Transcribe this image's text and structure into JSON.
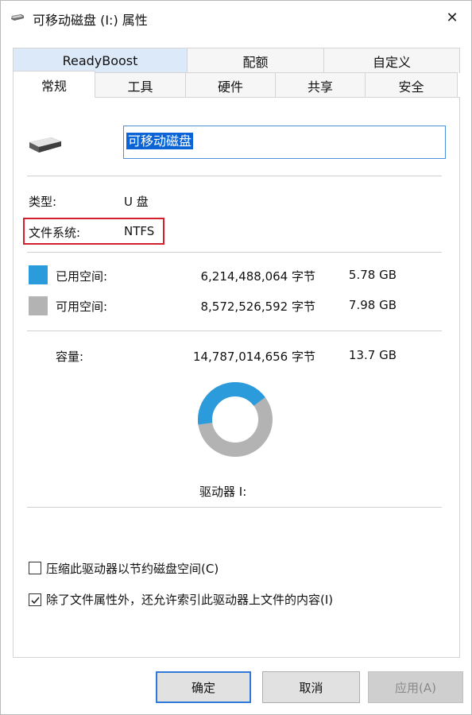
{
  "window": {
    "title": "可移动磁盘 (I:) 属性",
    "close_glyph": "✕"
  },
  "tabs": {
    "back_row": [
      {
        "label": "ReadyBoost",
        "highlight": true
      },
      {
        "label": "配额"
      },
      {
        "label": "自定义"
      }
    ],
    "front_row": [
      {
        "label": "常规",
        "active": true
      },
      {
        "label": "工具"
      },
      {
        "label": "硬件"
      },
      {
        "label": "共享"
      },
      {
        "label": "安全"
      }
    ]
  },
  "general": {
    "drive_name": "可移动磁盘",
    "type_label": "类型:",
    "type_value": "U 盘",
    "fs_label": "文件系统:",
    "fs_value": "NTFS",
    "used": {
      "label": "已用空间:",
      "bytes": "6,214,488,064 字节",
      "size": "5.78 GB",
      "color": "#2b9bdc"
    },
    "free": {
      "label": "可用空间:",
      "bytes": "8,572,526,592 字节",
      "size": "7.98 GB",
      "color": "#b3b3b3"
    },
    "capacity": {
      "label": "容量:",
      "bytes": "14,787,014,656 字节",
      "size": "13.7 GB"
    },
    "drive_label": "驱动器 I:",
    "used_fraction": 0.42
  },
  "options": {
    "compress": {
      "label": "压缩此驱动器以节约磁盘空间(C)",
      "checked": false
    },
    "index": {
      "label": "除了文件属性外，还允许索引此驱动器上文件的内容(I)",
      "checked": true
    }
  },
  "buttons": {
    "ok": "确定",
    "cancel": "取消",
    "apply": "应用(A)"
  }
}
